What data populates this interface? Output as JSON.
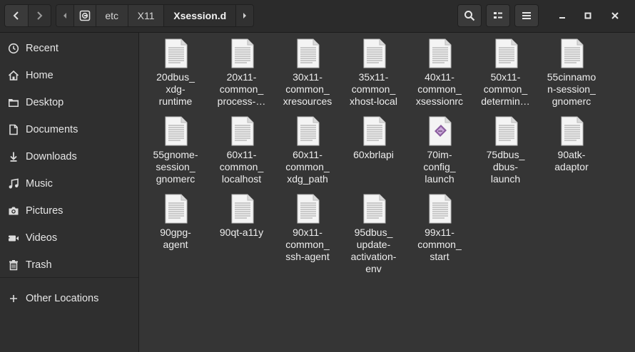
{
  "header": {
    "path": [
      "etc",
      "X11",
      "Xsession.d"
    ],
    "back_icon": "chevron-left-icon",
    "forward_icon": "chevron-right-icon",
    "search_icon": "search-icon",
    "view_icon": "list-view-icon",
    "menu_icon": "hamburger-menu-icon",
    "minimize_icon": "minimize-icon",
    "maximize_icon": "maximize-icon",
    "close_icon": "close-icon"
  },
  "sidebar": {
    "items": [
      {
        "label": "Recent",
        "icon": "clock-icon"
      },
      {
        "label": "Home",
        "icon": "home-icon"
      },
      {
        "label": "Desktop",
        "icon": "folder-icon"
      },
      {
        "label": "Documents",
        "icon": "document-icon"
      },
      {
        "label": "Downloads",
        "icon": "download-icon"
      },
      {
        "label": "Music",
        "icon": "music-icon"
      },
      {
        "label": "Pictures",
        "icon": "camera-icon"
      },
      {
        "label": "Videos",
        "icon": "video-icon"
      },
      {
        "label": "Trash",
        "icon": "trash-icon"
      }
    ],
    "other_locations": {
      "label": "Other Locations",
      "icon": "plus-icon"
    }
  },
  "files": [
    {
      "name": "20dbus_\nxdg-\nruntime",
      "type": "text"
    },
    {
      "name": "20x11-\ncommon_\nprocess-…",
      "type": "text"
    },
    {
      "name": "30x11-\ncommon_\nxresources",
      "type": "text"
    },
    {
      "name": "35x11-\ncommon_\nxhost-local",
      "type": "text"
    },
    {
      "name": "40x11-\ncommon_\nxsessionrc",
      "type": "text"
    },
    {
      "name": "50x11-\ncommon_\ndetermin…",
      "type": "text"
    },
    {
      "name": "55cinnamo\nn-session_\ngnomerc",
      "type": "text"
    },
    {
      "name": "55gnome-\nsession_\ngnomerc",
      "type": "text"
    },
    {
      "name": "60x11-\ncommon_\nlocalhost",
      "type": "text"
    },
    {
      "name": "60x11-\ncommon_\nxdg_path",
      "type": "text"
    },
    {
      "name": "60xbrlapi",
      "type": "text"
    },
    {
      "name": "70im-\nconfig_\nlaunch",
      "type": "script"
    },
    {
      "name": "75dbus_\ndbus-\nlaunch",
      "type": "text"
    },
    {
      "name": "90atk-\nadaptor",
      "type": "text"
    },
    {
      "name": "90gpg-\nagent",
      "type": "text"
    },
    {
      "name": "90qt-a11y",
      "type": "text"
    },
    {
      "name": "90x11-\ncommon_\nssh-agent",
      "type": "text"
    },
    {
      "name": "95dbus_\nupdate-\nactivation-\nenv",
      "type": "text"
    },
    {
      "name": "99x11-\ncommon_\nstart",
      "type": "text"
    }
  ]
}
